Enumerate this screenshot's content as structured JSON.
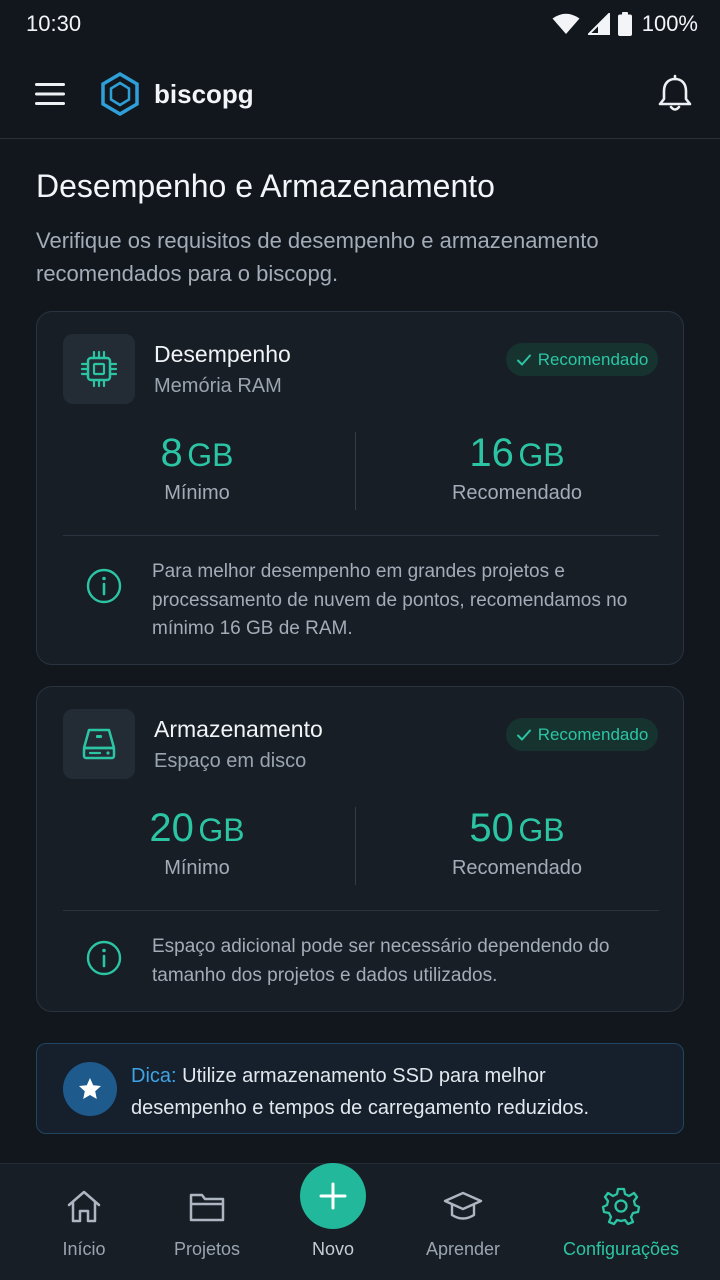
{
  "status": {
    "time": "10:30",
    "battery": "100%"
  },
  "app": {
    "name": "biscopg"
  },
  "page": {
    "title": "Desempenho e Armazenamento",
    "subtitle": "Verifique os requisitos de desempenho e armazenamento recomendados para o biscopg."
  },
  "cards": [
    {
      "title": "Desempenho",
      "subtitle": "Memória RAM",
      "badge": "Recomendado",
      "icon": "cpu-chip-icon",
      "min_value": "8",
      "min_unit": "GB",
      "min_label": "Mínimo",
      "rec_value": "16",
      "rec_unit": "GB",
      "rec_label": "Recomendado",
      "info": "Para melhor desempenho em grandes projetos e processamento de nuvem de pontos, recomendamos no mínimo 16 GB de RAM."
    },
    {
      "title": "Armazenamento",
      "subtitle": "Espaço em disco",
      "badge": "Recomendado",
      "icon": "hard-drive-icon",
      "min_value": "20",
      "min_unit": "GB",
      "min_label": "Mínimo",
      "rec_value": "50",
      "rec_unit": "GB",
      "rec_label": "Recomendado",
      "info": "Espaço adicional pode ser necessário dependendo do tamanho dos projetos e dados utilizados."
    }
  ],
  "tip": {
    "label": "Dica:",
    "text": " Utilize armazenamento SSD para melhor desempenho e tempos de carregamento reduzidos."
  },
  "nav": {
    "items": [
      {
        "label": "Início",
        "icon": "home-icon"
      },
      {
        "label": "Projetos",
        "icon": "folder-icon"
      },
      {
        "label": "Novo",
        "icon": "plus-icon"
      },
      {
        "label": "Aprender",
        "icon": "graduation-cap-icon"
      },
      {
        "label": "Configurações",
        "icon": "gear-icon"
      }
    ],
    "active": "Configurações"
  },
  "colors": {
    "background": "#12171e",
    "accent": "#2cc5a4",
    "card": "#171e26",
    "tip_accent": "#3ea3e6"
  }
}
